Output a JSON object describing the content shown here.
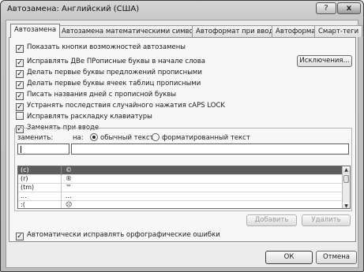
{
  "window": {
    "title": "Автозамена: Английский (США)",
    "help_glyph": "?",
    "close_glyph": "x"
  },
  "tabs": [
    {
      "label": "Автозамена",
      "active": true
    },
    {
      "label": "Автозамена математическими символами",
      "active": false
    },
    {
      "label": "Автоформат при вводе",
      "active": false
    },
    {
      "label": "Автоформат",
      "active": false
    },
    {
      "label": "Смарт-теги",
      "active": false
    }
  ],
  "options": {
    "show_buttons": {
      "label": "Показать кнопки возможностей автозамены",
      "checked": true
    },
    "fix_two_caps": {
      "label": "Исправлять ДВе ПРописные буквы в начале слова",
      "checked": true
    },
    "capitalize_sentences": {
      "label": "Делать первые буквы предложений прописными",
      "checked": true
    },
    "capitalize_table_cells": {
      "label": "Делать первые буквы ячеек таблиц прописными",
      "checked": true
    },
    "capitalize_days": {
      "label": "Писать названия дней с прописной буквы",
      "checked": true
    },
    "fix_caps_lock": {
      "label": "Устранять последствия случайного нажатия cAPS LOCK",
      "checked": true
    },
    "fix_keyboard_layout": {
      "label": "Исправлять раскладку клавиатуры",
      "checked": false
    },
    "replace_as_you_type": {
      "label": "Заменять при вводе",
      "checked": true
    },
    "auto_spelling": {
      "label": "Автоматически исправлять орфографические ошибки",
      "checked": true
    }
  },
  "exceptions_button": "Исключения...",
  "replace_label": "заменить:",
  "with_label": "на:",
  "plain_text_label": "обычный текст",
  "formatted_text_label": "форматированный текст",
  "plain_text_selected": true,
  "replace_value": "",
  "with_value": "",
  "entries": [
    {
      "from": "(c)",
      "to": "©",
      "selected": true
    },
    {
      "from": "(r)",
      "to": "®",
      "selected": false
    },
    {
      "from": "(tm)",
      "to": "™",
      "selected": false
    },
    {
      "from": "...",
      "to": "…",
      "selected": false
    },
    {
      "from": ":(",
      "to": "☹",
      "selected": false
    }
  ],
  "add_button": "Добавить",
  "delete_button": "Удалить",
  "ok_button": "ОК",
  "cancel_button": "Отмена",
  "check_glyph": "✓",
  "scroll_up_glyph": "▲",
  "scroll_down_glyph": "▼"
}
